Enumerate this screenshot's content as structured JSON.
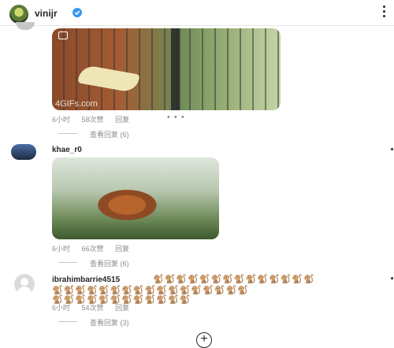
{
  "header": {
    "username": "vinijr",
    "verified_icon": "verified-badge-icon",
    "menu_icon": "more-vertical-icon"
  },
  "posts": [
    {
      "image_watermark": "4GIFs.com",
      "time": "6小时",
      "likes": "58次赞",
      "reply": "回复",
      "more": "• • •",
      "view_replies": "查看回复 (6)"
    },
    {
      "username": "khae_r0",
      "time": "6小时",
      "likes": "66次赞",
      "reply": "回复",
      "view_replies": "查看回复 (6)"
    },
    {
      "username": "ibrahimbarrie4515",
      "emoji_line1": "🐒🐒🐒🐒🐒🐒🐒🐒🐒🐒🐒🐒🐒🐒",
      "emoji_line2": "🐒🐒🐒🐒🐒🐒🐒🐒🐒🐒🐒🐒🐒🐒🐒🐒🐒",
      "emoji_line3": "🐒🐒🐒🐒🐒🐒🐒🐒🐒🐒🐒🐒",
      "time": "6小时",
      "likes": "54次赞",
      "reply": "回复",
      "view_replies": "查看回复 (3)"
    }
  ],
  "footer": {
    "add_icon": "plus-circle-icon",
    "add_symbol": "+"
  }
}
